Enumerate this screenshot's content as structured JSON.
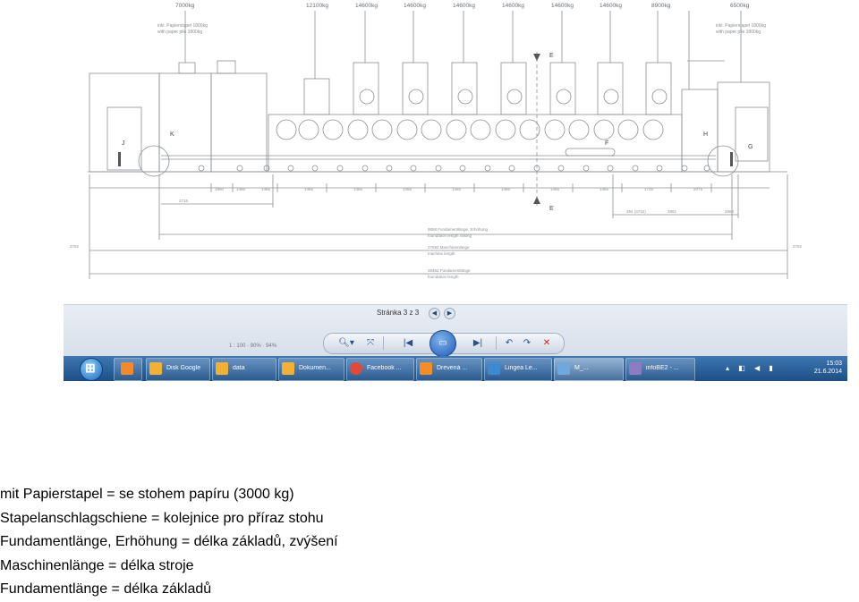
{
  "drawing": {
    "top_weights": [
      "7000kg",
      "12100kg",
      "14600kg",
      "14600kg",
      "14600kg",
      "14600kg",
      "14600kg",
      "14600kg",
      "8900kg",
      "6500kg"
    ],
    "left_note": [
      "inkl. Papierstapel 1800kg",
      "with paper pile 1800kg"
    ],
    "right_note": [
      "inkl. Papierstapel 1800kg",
      "with paper pile 1800kg"
    ],
    "marker_labels": {
      "E_top": "E",
      "E_bottom": "E",
      "F": "F",
      "G": "G",
      "H": "H",
      "J": "J",
      "K": "K"
    },
    "dim_segments": [
      "1950",
      "1465",
      "1465",
      "1465",
      "1465",
      "1465",
      "1465",
      "1465",
      "1465",
      "1465",
      "1735",
      "2075"
    ],
    "dim_left_small": "2715",
    "dim_right_group": [
      "284 (3742)",
      "2852",
      "2562"
    ],
    "dim_fund": [
      "9858 Fundamentlänge, Erhöhung",
      "foundation length raising"
    ],
    "dim_machine": [
      "27592 Maschinenlänge",
      "machine length"
    ],
    "dim_fund2": [
      "28452 Fundamentlänge",
      "foundation length"
    ],
    "dim_left_end": "2762",
    "dim_right_end": "2762"
  },
  "viewer": {
    "page_info": "Stránka 3 z 3",
    "prev_icon": "chevron-left-icon",
    "next_icon": "chevron-right-icon",
    "status_left": "1 : 100 · 90% · 94%"
  },
  "taskbar": {
    "items": [
      {
        "label": "Disk Google",
        "color": "#f2b133"
      },
      {
        "label": "data",
        "color": "#f2b133"
      },
      {
        "label": "Dokumen...",
        "color": "#f2b133"
      },
      {
        "label": "Facebook ...",
        "color": "#e04a3b"
      },
      {
        "label": "Drevená ...",
        "color": "#f58c28"
      },
      {
        "label": "Lingea Le...",
        "color": "#3d8ad1"
      },
      {
        "label": "M_...",
        "color": "#6fa8dc"
      },
      {
        "label": "infoBE2 - ...",
        "color": "#8e7cc3"
      }
    ],
    "clock_time": "15:03",
    "clock_date": "21.6.2014"
  },
  "caption": {
    "lines": [
      "mit Papierstapel = se stohem papíru (3000 kg)",
      "Stapelanschlagschiene = kolejnice pro příraz stohu",
      "Fundamentlänge, Erhöhung = délka základů, zvýšení",
      "Maschinenlänge = délka stroje",
      "Fundamentlänge = délka základů"
    ]
  }
}
